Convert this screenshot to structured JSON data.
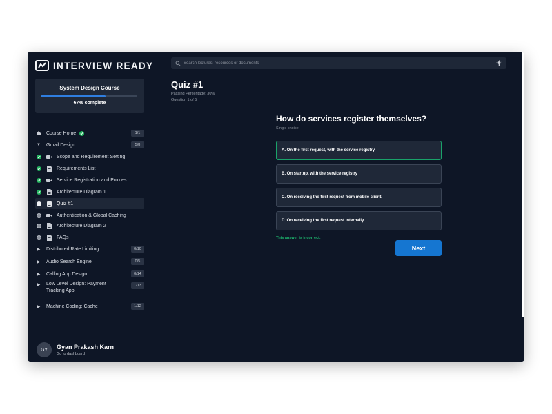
{
  "brand": {
    "name": "INTERVIEW READY",
    "logo_icon": "interview-ready-logo"
  },
  "course": {
    "title": "System Design Course",
    "progress_percent": 67,
    "progress_text": "67% complete"
  },
  "nav": {
    "course_home": {
      "label": "Course Home",
      "badge": "1/1",
      "icon": "home-icon"
    },
    "gmail_design": {
      "label": "Gmail Design",
      "badge": "5/8",
      "items": [
        {
          "label": "Scope and Requirement Setting",
          "status": "complete",
          "icon": "video-icon"
        },
        {
          "label": "Requirements List",
          "status": "complete",
          "icon": "document-icon"
        },
        {
          "label": "Service Registration and Proxies",
          "status": "complete",
          "icon": "video-icon"
        },
        {
          "label": "Architecture Diagram 1",
          "status": "complete",
          "icon": "document-icon"
        },
        {
          "label": "Quiz #1",
          "status": "current",
          "icon": "clipboard-icon"
        },
        {
          "label": "Authentication & Global Caching",
          "status": "incomplete",
          "icon": "video-icon"
        },
        {
          "label": "Architecture Diagram 2",
          "status": "incomplete",
          "icon": "document-icon"
        },
        {
          "label": "FAQs",
          "status": "incomplete",
          "icon": "document-icon"
        }
      ]
    },
    "sections": [
      {
        "label": "Distributed Rate Limiting",
        "badge": "0/10"
      },
      {
        "label": "Audio Search Engine",
        "badge": "0/5"
      },
      {
        "label": "Calling App Design",
        "badge": "0/14"
      },
      {
        "label": "Low Level Design: Payment Tracking App",
        "badge": "1/13"
      },
      {
        "label": "Machine Coding: Cache",
        "badge": "1/12"
      }
    ]
  },
  "user": {
    "initials": "GY",
    "name": "Gyan Prakash Karn",
    "link": "Go to dashboard"
  },
  "search": {
    "placeholder": "Search lectures, resources or documents"
  },
  "quiz": {
    "title": "Quiz #1",
    "passing": "Passing Percentage: 30%",
    "question_counter": "Question 1 of 5",
    "question": "How do services register themselves?",
    "type": "Single choice",
    "options": [
      "A. On the first request, with the service registry",
      "B. On startup, with the service registry",
      "C. On receiving the first request from mobile client.",
      "D. On receiving the first request internally."
    ],
    "selected_index": 0,
    "feedback": "This answer is incorrect.",
    "next_label": "Next"
  },
  "colors": {
    "background": "#0e1626",
    "panel": "#1f2838",
    "accent": "#1576d1",
    "success": "#22b35e",
    "selected_border": "#1aa36a"
  }
}
